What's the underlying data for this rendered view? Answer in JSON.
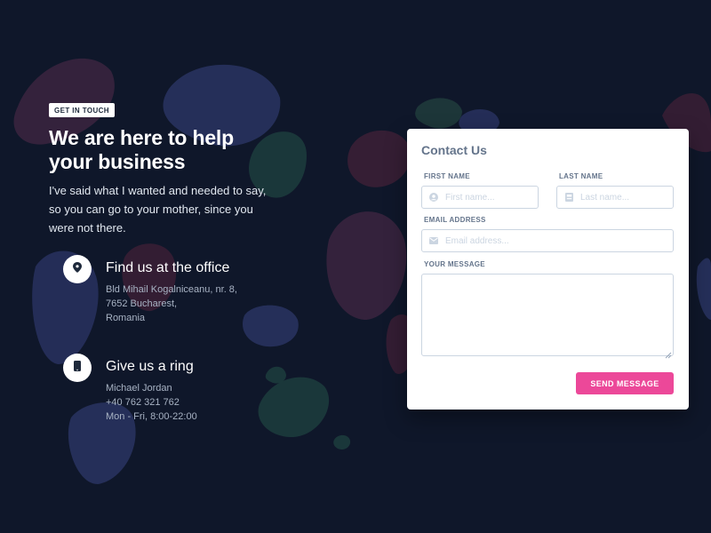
{
  "intro": {
    "badge": "GET IN TOUCH",
    "headline": "We are here to help your business",
    "lead": "I've said what I wanted and needed to say, so you can go to your mother, since you were not there."
  },
  "office": {
    "icon": "map-pin-icon",
    "title": "Find us at the office",
    "lines": [
      "Bld Mihail Kogalniceanu, nr. 8,",
      "7652 Bucharest,",
      "Romania"
    ]
  },
  "ring": {
    "icon": "phone-icon",
    "title": "Give us a ring",
    "lines": [
      "Michael Jordan",
      "+40 762 321 762",
      "Mon - Fri, 8:00-22:00"
    ]
  },
  "form": {
    "title": "Contact Us",
    "first_name": {
      "label": "FIRST NAME",
      "placeholder": "First name...",
      "icon": "user-circle-icon",
      "value": ""
    },
    "last_name": {
      "label": "LAST NAME",
      "placeholder": "Last name...",
      "icon": "id-card-icon",
      "value": ""
    },
    "email": {
      "label": "EMAIL ADDRESS",
      "placeholder": "Email address...",
      "icon": "envelope-icon",
      "value": ""
    },
    "message": {
      "label": "YOUR MESSAGE",
      "value": ""
    },
    "submit": "SEND MESSAGE"
  },
  "colors": {
    "background": "#0f172a",
    "accent": "#ec4899",
    "card": "#ffffff"
  }
}
